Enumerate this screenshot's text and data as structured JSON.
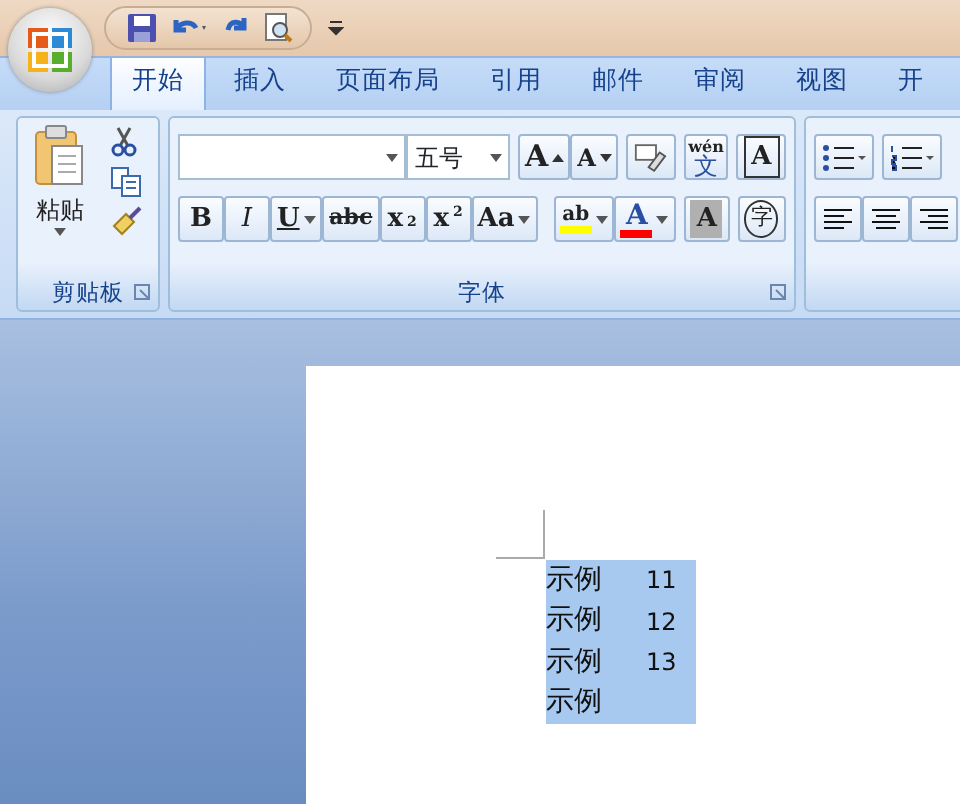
{
  "tabs": [
    {
      "label": "开始",
      "selected": true
    },
    {
      "label": "插入",
      "selected": false
    },
    {
      "label": "页面布局",
      "selected": false
    },
    {
      "label": "引用",
      "selected": false
    },
    {
      "label": "邮件",
      "selected": false
    },
    {
      "label": "审阅",
      "selected": false
    },
    {
      "label": "视图",
      "selected": false
    },
    {
      "label": "开",
      "selected": false
    }
  ],
  "clipboard": {
    "paste_label": "粘贴",
    "group_label": "剪贴板"
  },
  "font": {
    "font_size": "五号",
    "group_label": "字体",
    "row1": [
      {
        "kind": "grow",
        "label": "A"
      },
      {
        "kind": "shrink",
        "label": "A"
      },
      {
        "kind": "clear"
      },
      {
        "kind": "phonetic",
        "label": "wén",
        "sub": "文"
      },
      {
        "kind": "boxed",
        "label": "A"
      }
    ],
    "row2": [
      {
        "kind": "bold",
        "label": "B"
      },
      {
        "kind": "italic",
        "label": "I"
      },
      {
        "kind": "underline",
        "label": "U"
      },
      {
        "kind": "strike",
        "label": "abc"
      },
      {
        "kind": "sub",
        "label": "x",
        "script": "2"
      },
      {
        "kind": "sup",
        "label": "x",
        "script": "2"
      },
      {
        "kind": "case",
        "label": "Aa"
      },
      {
        "kind": "highlight",
        "label": "ab",
        "color": "#ffff00"
      },
      {
        "kind": "fontcolor",
        "label": "A",
        "color": "#ff0000"
      },
      {
        "kind": "shade",
        "label": "A"
      },
      {
        "kind": "enclose",
        "label": "字"
      }
    ]
  },
  "document": {
    "lines": [
      {
        "text": "示例",
        "number": "11",
        "selected": true
      },
      {
        "text": "示例",
        "number": "12",
        "selected": true
      },
      {
        "text": "示例",
        "number": "13",
        "selected": true
      },
      {
        "text": "示例",
        "selected": true
      }
    ]
  }
}
